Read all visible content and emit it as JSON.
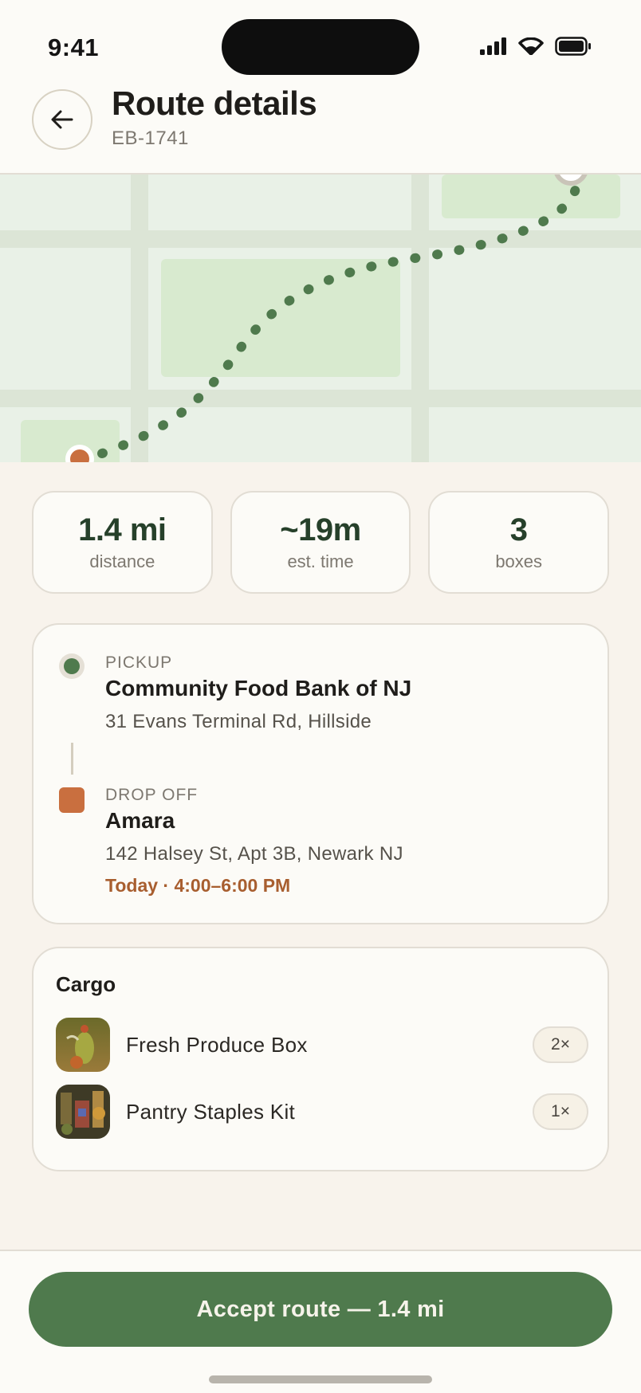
{
  "status_bar": {
    "time": "9:41"
  },
  "header": {
    "title": "Route details",
    "route_id": "EB-1741"
  },
  "stats": [
    {
      "value": "1.4 mi",
      "label": "distance"
    },
    {
      "value": "~19m",
      "label": "est. time"
    },
    {
      "value": "3",
      "label": "boxes"
    }
  ],
  "route": {
    "pickup": {
      "label": "PICKUP",
      "name": "Community Food Bank of NJ",
      "address": "31 Evans Terminal Rd, Hillside"
    },
    "dropoff": {
      "label": "DROP OFF",
      "name": "Amara",
      "address": "142 Halsey St, Apt 3B, Newark NJ",
      "window": "Today · 4:00–6:00 PM"
    }
  },
  "cargo": {
    "title": "Cargo",
    "items": [
      {
        "name": "Fresh Produce Box",
        "qty": "2×"
      },
      {
        "name": "Pantry Staples Kit",
        "qty": "1×"
      }
    ]
  },
  "footer": {
    "accept_label": "Accept route — 1.4 mi"
  },
  "colors": {
    "accent_green": "#4f7a4d",
    "dropoff_orange": "#c96f3f",
    "background": "#f8f3ec",
    "card": "#fcfbf7"
  }
}
